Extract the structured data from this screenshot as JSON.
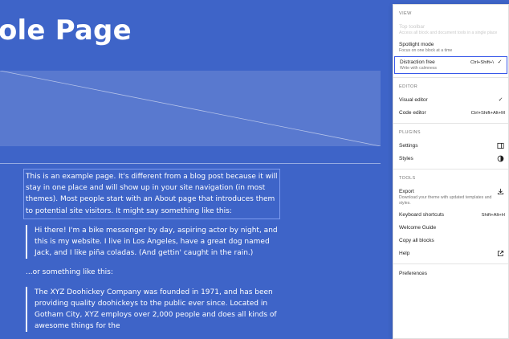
{
  "editor": {
    "title": "ole Page",
    "paragraph1": "This is an example page. It's different from a blog post because it will stay in one place and will show up in your site navigation (in most themes). Most people start with an About page that introduces them to potential site visitors. It might say something like this:",
    "quote1": "Hi there! I'm a bike messenger by day, aspiring actor by night, and this is my website. I live in Los Angeles, have a great dog named Jack, and I like piña coladas. (And gettin' caught in the rain.)",
    "paragraph2": "...or something like this:",
    "quote2": "The XYZ Doohickey Company was founded in 1971, and has been providing quality doohickeys to the public ever since. Located in Gotham City, XYZ employs over 2,000 people and does all kinds of awesome things for the"
  },
  "menu": {
    "view": {
      "label": "VIEW",
      "top_toolbar": {
        "label": "Top toolbar",
        "desc": "Access all block and document tools in a single place"
      },
      "spotlight": {
        "label": "Spotlight mode",
        "desc": "Focus on one block at a time"
      },
      "distraction_free": {
        "label": "Distraction free",
        "desc": "Write with calmness",
        "shortcut": "Ctrl+Shift+\\"
      }
    },
    "editor": {
      "label": "EDITOR",
      "visual": {
        "label": "Visual editor"
      },
      "code": {
        "label": "Code editor",
        "shortcut": "Ctrl+Shift+Alt+M"
      }
    },
    "plugins": {
      "label": "PLUGINS",
      "settings": {
        "label": "Settings"
      },
      "styles": {
        "label": "Styles"
      }
    },
    "tools": {
      "label": "TOOLS",
      "export": {
        "label": "Export",
        "desc": "Download your theme with updated templates and styles."
      },
      "shortcuts": {
        "label": "Keyboard shortcuts",
        "shortcut": "Shift+Alt+H"
      },
      "welcome": {
        "label": "Welcome Guide"
      },
      "copy": {
        "label": "Copy all blocks"
      },
      "help": {
        "label": "Help"
      }
    },
    "preferences": {
      "label": "Preferences"
    }
  },
  "colors": {
    "background": "#3e64c8",
    "accent": "#3858e9"
  }
}
